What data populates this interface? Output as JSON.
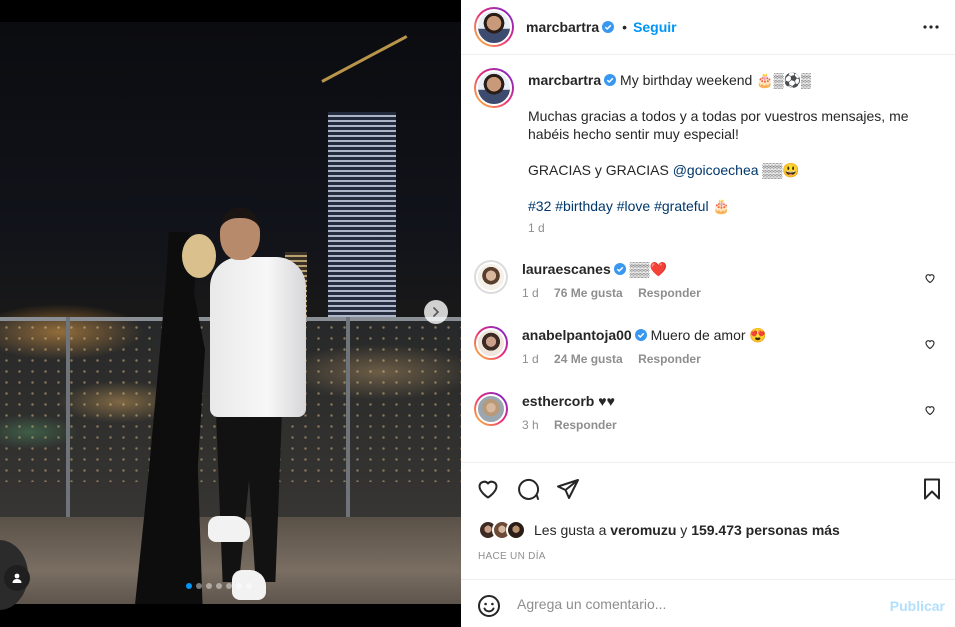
{
  "post": {
    "author": "marcbartra",
    "follow_label": "Seguir",
    "separator": "•"
  },
  "caption": {
    "username": "marcbartra",
    "title": "My birthday weekend 🎂▒⚽▒",
    "line2": "Muchas gracias a todos y a todas por vuestros mensajes, me habéis hecho sentir muy especial!",
    "line3_text": "GRACIAS y GRACIAS",
    "line3_mention": "@goicoechea",
    "line3_emoji": "▒▒😃",
    "hashtags": "#32 #birthday #love #grateful",
    "hashtags_emoji": "🎂",
    "time": "1 d"
  },
  "comments": [
    {
      "username": "lauraescanes",
      "text": "▒▒❤️",
      "time": "1 d",
      "likes": "76 Me gusta",
      "reply": "Responder"
    },
    {
      "username": "anabelpantoja00",
      "text": "Muero de amor 😍",
      "time": "1 d",
      "likes": "24 Me gusta",
      "reply": "Responder"
    },
    {
      "username": "esthercorb",
      "text": "♥♥",
      "time": "3 h",
      "reply": "Responder"
    }
  ],
  "likes": {
    "prefix": "Les gusta a",
    "user": "veromuzu",
    "connector": "y",
    "others": "159.473 personas más"
  },
  "time_ago": "HACE UN DÍA",
  "composer": {
    "placeholder": "Agrega un comentario...",
    "publish_label": "Publicar"
  },
  "carousel": {
    "total": 7,
    "current": 1
  },
  "icons": {
    "more": "more-horizontal-icon",
    "like": "heart-icon",
    "comment": "comment-icon",
    "share": "paper-plane-icon",
    "save": "bookmark-icon",
    "emoji": "smiley-icon",
    "verified": "verified-badge-icon",
    "next": "chevron-right-icon",
    "tag": "person-tag-icon"
  },
  "colors": {
    "accent": "#0095f6",
    "publish_disabled": "#b2dffc",
    "link": "#00376b",
    "muted": "#8e8e8e",
    "text": "#262626"
  }
}
